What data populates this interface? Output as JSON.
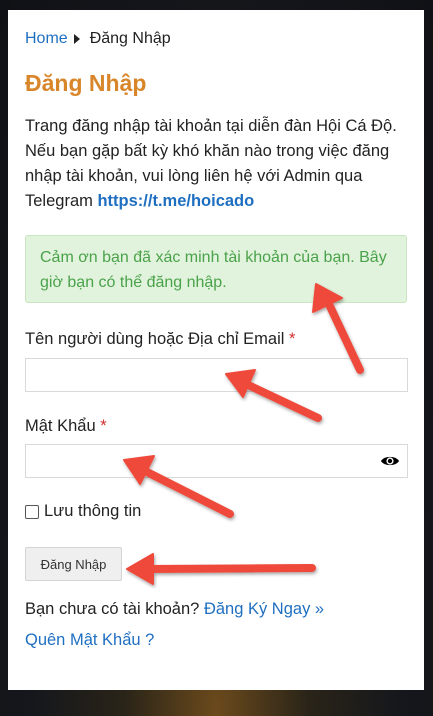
{
  "breadcrumb": {
    "home": "Home",
    "current": "Đăng Nhập"
  },
  "page_title": "Đăng Nhập",
  "intro": {
    "text": "Trang đăng nhập tài khoản tại diễn đàn Hội Cá Độ. Nếu bạn gặp bất kỳ khó khăn nào trong việc đăng nhập tài khoản, vui lòng liên hệ với Admin qua Telegram",
    "link": "https://t.me/hoicado"
  },
  "notice": "Cảm ơn bạn đã xác minh tài khoản của bạn. Bây giờ bạn có thể đăng nhập.",
  "username": {
    "label": "Tên người dùng hoặc Địa chỉ Email",
    "required_mark": "*",
    "value": ""
  },
  "password": {
    "label": "Mật Khẩu",
    "required_mark": "*",
    "value": ""
  },
  "remember": {
    "label": "Lưu thông tin"
  },
  "submit_label": "Đăng Nhập",
  "register": {
    "prompt": "Bạn chưa có tài khoản?",
    "link": "Đăng Ký Ngay »"
  },
  "forgot_link": "Quên Mật Khẩu ?",
  "colors": {
    "title": "#d9862a",
    "link": "#1f6fc1",
    "notice_bg": "#e1f3dc",
    "notice_text": "#4aa24a",
    "arrow": "#ef4a3a"
  },
  "icons": {
    "breadcrumb_sep": "caret-right-icon",
    "password_toggle": "eye-icon"
  }
}
